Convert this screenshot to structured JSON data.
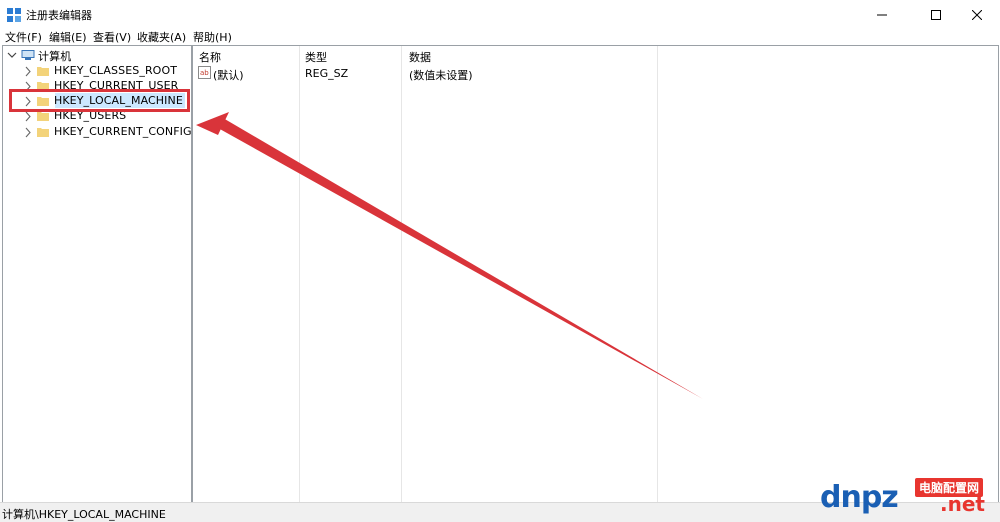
{
  "window": {
    "title": "注册表编辑器",
    "minimize_glyph": "—",
    "maximize_glyph": "☐",
    "close_glyph": "✕"
  },
  "menu": [
    "文件(F)",
    "编辑(E)",
    "查看(V)",
    "收藏夹(A)",
    "帮助(H)"
  ],
  "tree": {
    "root": "计算机",
    "items": [
      "HKEY_CLASSES_ROOT",
      "HKEY_CURRENT_USER",
      "HKEY_LOCAL_MACHINE",
      "HKEY_USERS",
      "HKEY_CURRENT_CONFIG"
    ],
    "selected": "HKEY_LOCAL_MACHINE"
  },
  "list": {
    "columns": [
      "名称",
      "类型",
      "数据"
    ],
    "rows": [
      {
        "name": "(默认)",
        "type": "REG_SZ",
        "data": "(数值未设置)"
      }
    ]
  },
  "status": "计算机\\HKEY_LOCAL_MACHINE",
  "annotation": {
    "color": "#d9343a"
  },
  "watermark": {
    "badge": "电脑配置网",
    "logo": "dnpz",
    "suffix": ".net"
  }
}
